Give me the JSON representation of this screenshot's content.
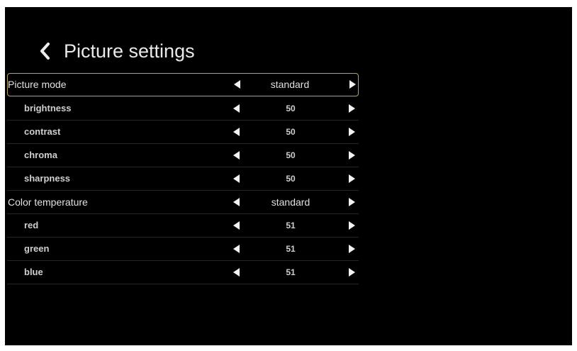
{
  "header": {
    "title": "Picture settings"
  },
  "menu": {
    "picture_mode": {
      "label": "Picture mode",
      "value": "standard"
    },
    "brightness": {
      "label": "brightness",
      "value": "50"
    },
    "contrast": {
      "label": "contrast",
      "value": "50"
    },
    "chroma": {
      "label": "chroma",
      "value": "50"
    },
    "sharpness": {
      "label": "sharpness",
      "value": "50"
    },
    "color_temperature": {
      "label": "Color temperature",
      "value": "standard"
    },
    "red": {
      "label": "red",
      "value": "51"
    },
    "green": {
      "label": "green",
      "value": "51"
    },
    "blue": {
      "label": "blue",
      "value": "51"
    }
  },
  "icons": {
    "back": "chevron-left-icon",
    "decrease": "arrow-left-icon",
    "increase": "arrow-right-icon"
  },
  "colors": {
    "background": "#000000",
    "text": "#e3e3e3",
    "selection_border": "#b7a15b"
  }
}
